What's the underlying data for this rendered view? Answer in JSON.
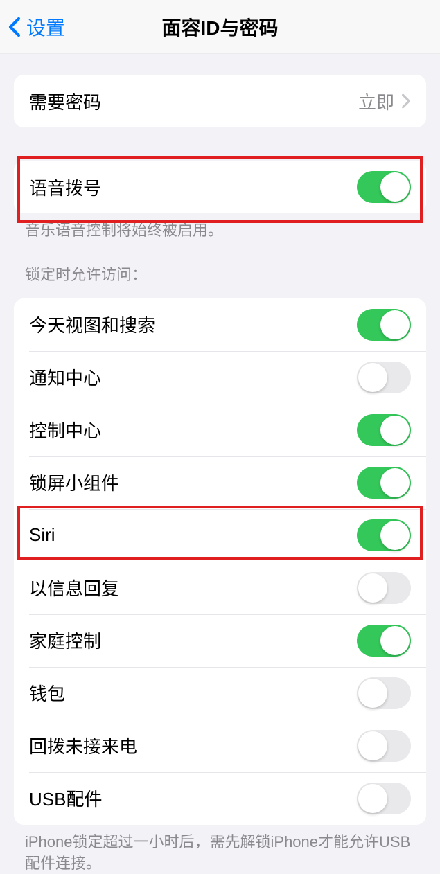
{
  "nav": {
    "back_label": "设置",
    "title": "面容ID与密码"
  },
  "passcode_section": {
    "label": "需要密码",
    "value": "立即"
  },
  "voice_dial": {
    "label": "语音拨号",
    "footer": "音乐语音控制将始终被启用。"
  },
  "lock_access": {
    "header": "锁定时允许访问：",
    "items": [
      {
        "label": "今天视图和搜索",
        "on": true
      },
      {
        "label": "通知中心",
        "on": false
      },
      {
        "label": "控制中心",
        "on": true
      },
      {
        "label": "锁屏小组件",
        "on": true
      },
      {
        "label": "Siri",
        "on": true
      },
      {
        "label": "以信息回复",
        "on": false
      },
      {
        "label": "家庭控制",
        "on": true
      },
      {
        "label": "钱包",
        "on": false
      },
      {
        "label": "回拨未接来电",
        "on": false
      },
      {
        "label": "USB配件",
        "on": false
      }
    ],
    "footer": "iPhone锁定超过一小时后，需先解锁iPhone才能允许USB配件连接。"
  }
}
